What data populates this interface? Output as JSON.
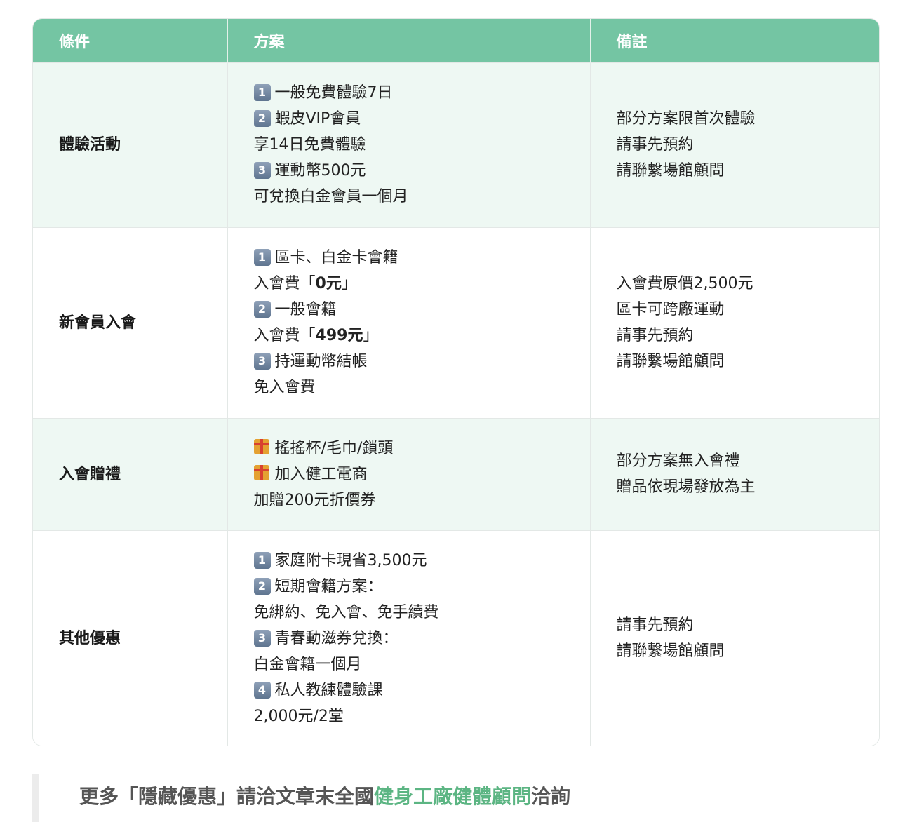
{
  "table": {
    "headers": [
      "條件",
      "方案",
      "備註"
    ],
    "rows": [
      {
        "condition": "體驗活動",
        "plan": [
          {
            "badge": "1",
            "text": "一般免費體驗7日"
          },
          {
            "badge": "2",
            "text": "蝦皮VIP會員"
          },
          {
            "text": "享14日免費體驗"
          },
          {
            "badge": "3",
            "text": "運動幣500元"
          },
          {
            "text": "可兌換白金會員一個月"
          }
        ],
        "notes": [
          "部分方案限首次體驗",
          "請事先預約",
          "請聯繫場館顧問"
        ]
      },
      {
        "condition": "新會員入會",
        "plan": [
          {
            "badge": "1",
            "text": "區卡、白金卡會籍"
          },
          {
            "pre": "入會費「",
            "strong": "0元",
            "post": "」"
          },
          {
            "badge": "2",
            "text": "一般會籍"
          },
          {
            "pre": "入會費「",
            "strong": "499元",
            "post": "」"
          },
          {
            "badge": "3",
            "text": "持運動幣結帳"
          },
          {
            "text": "免入會費"
          }
        ],
        "notes": [
          "入會費原價2,500元",
          "區卡可跨廠運動",
          "請事先預約",
          "請聯繫場館顧問"
        ]
      },
      {
        "condition": "入會贈禮",
        "plan": [
          {
            "icon": "gift-icon",
            "text": "搖搖杯/毛巾/鎖頭"
          },
          {
            "icon": "gift-icon",
            "text": "加入健工電商"
          },
          {
            "text": "加贈200元折價券"
          }
        ],
        "notes": [
          "部分方案無入會禮",
          "贈品依現場發放為主"
        ]
      },
      {
        "condition": "其他優惠",
        "plan": [
          {
            "badge": "1",
            "text": "家庭附卡現省3,500元"
          },
          {
            "badge": "2",
            "text": "短期會籍方案："
          },
          {
            "text": "免綁約、免入會、免手續費"
          },
          {
            "badge": "3",
            "text": "青春動滋券兌換："
          },
          {
            "text": "白金會籍一個月"
          },
          {
            "badge": "4",
            "text": "私人教練體驗課"
          },
          {
            "text": "2,000元/2堂"
          }
        ],
        "notes": [
          "請事先預約",
          "請聯繫場館顧問"
        ]
      }
    ]
  },
  "footer": {
    "before": "更多「隱藏優惠」請洽文章末全國",
    "link": "健身工廠健體顧問",
    "after": "洽詢"
  },
  "colors": {
    "header_bg": "#74c5a3",
    "stripe_bg": "#eef8f3",
    "link": "#5cb583"
  }
}
